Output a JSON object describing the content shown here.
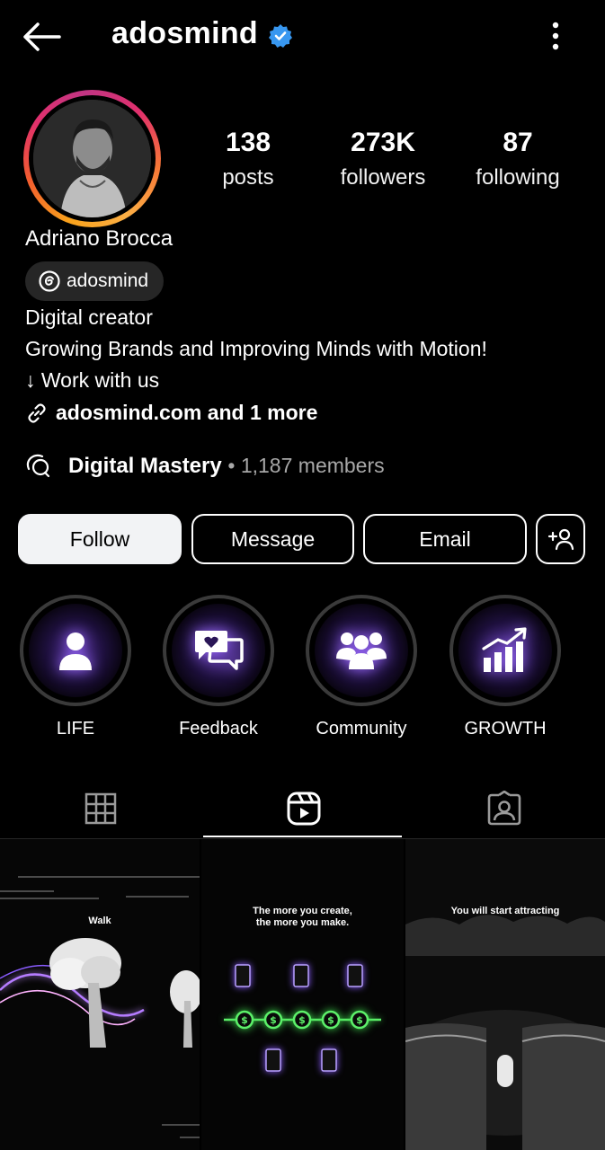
{
  "header": {
    "username": "adosmind",
    "back_icon": "arrow-left-icon",
    "verified_icon": "verified-badge-icon",
    "more_icon": "kebab-menu-icon",
    "verified_color": "#3897f0"
  },
  "profile": {
    "full_name": "Adriano Brocca",
    "threads_handle": "adosmind",
    "bio_lines": [
      "Digital creator",
      "Growing Brands and Improving Minds with Motion!",
      "↓ Work with us"
    ],
    "link_text": "adosmind.com and 1 more"
  },
  "stats": [
    {
      "value": "138",
      "label": "posts"
    },
    {
      "value": "273K",
      "label": "followers"
    },
    {
      "value": "87",
      "label": "following"
    }
  ],
  "channel": {
    "name": "Digital Mastery",
    "members": "• 1,187 members"
  },
  "buttons": {
    "follow": "Follow",
    "message": "Message",
    "email": "Email"
  },
  "highlights": [
    {
      "label": "LIFE",
      "icon": "person-icon"
    },
    {
      "label": "Feedback",
      "icon": "chat-heart-icon"
    },
    {
      "label": "Community",
      "icon": "group-icon"
    },
    {
      "label": "GROWTH",
      "icon": "bar-growth-icon"
    }
  ],
  "tabs": [
    {
      "name": "grid",
      "icon": "grid-icon",
      "active": false
    },
    {
      "name": "reels",
      "icon": "reels-icon",
      "active": true
    },
    {
      "name": "tagged",
      "icon": "tagged-person-icon",
      "active": false
    }
  ],
  "thumbnails": [
    {
      "caption": "Walk"
    },
    {
      "caption_lines": [
        "The more you create,",
        "the more you make."
      ]
    },
    {
      "caption": "You will start attracting"
    }
  ],
  "colors": {
    "glow": "#8a5cff",
    "money_green": "#3bd64a"
  }
}
